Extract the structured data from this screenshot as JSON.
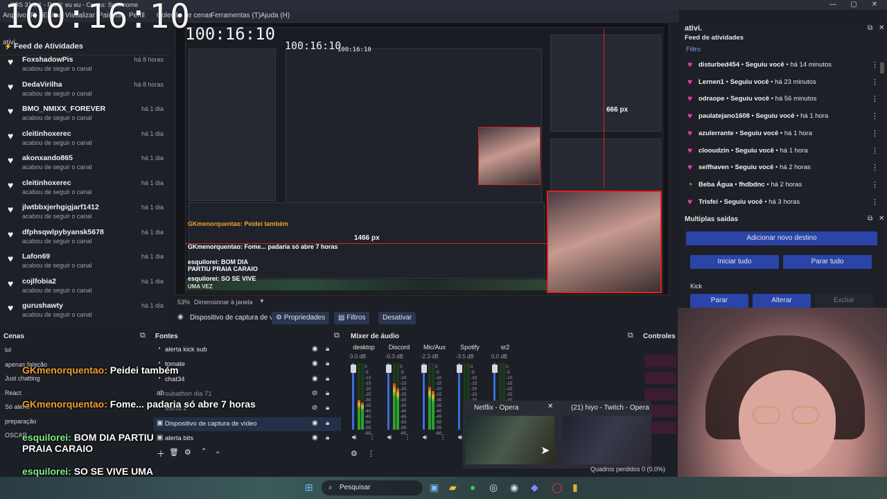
{
  "window": {
    "title": "OBS 31.1.1 - Perfil: eu eu - Cenas: Sem nome",
    "minimize": "—",
    "maximize": "▢",
    "close": "✕"
  },
  "menu": [
    "Arquivo (F)",
    "Editar",
    "Visualizar",
    "Painéis",
    "Perfil",
    "Coleção de cenas",
    "Ferramentas (T)",
    "Ajuda (H)"
  ],
  "clock": "100:16:10",
  "preview_clock_2": "100:16:10",
  "preview_clock_3": "100:16:10",
  "preview_clock_4": "100:16:10",
  "left_feed": {
    "dock_title": "ativi.",
    "title": "Feed de Atividades",
    "items": [
      {
        "name": "FoxshadowPis",
        "sub": "acabou de seguir o canal",
        "time": "há 8 horas"
      },
      {
        "name": "DedaVirilha",
        "sub": "acabou de seguir o canal",
        "time": "há 8 horas"
      },
      {
        "name": "BMO_NMIXX_FOREVER",
        "sub": "acabou de seguir o canal",
        "time": "há 1 dia"
      },
      {
        "name": "cleitinhoxerec",
        "sub": "acabou de seguir o canal",
        "time": "há 1 dia"
      },
      {
        "name": "akonxando865",
        "sub": "acabou de seguir o canal",
        "time": "há 1 dia"
      },
      {
        "name": "cleitinhoxerec",
        "sub": "acabou de seguir o canal",
        "time": "há 1 dia"
      },
      {
        "name": "jlwtbbxjerhgigjarf1412",
        "sub": "acabou de seguir o canal",
        "time": "há 1 dia"
      },
      {
        "name": "dfphsqwlpybyansk5678",
        "sub": "acabou de seguir o canal",
        "time": "há 1 dia"
      },
      {
        "name": "Lafon69",
        "sub": "acabou de seguir o canal",
        "time": "há 1 dia"
      },
      {
        "name": "cojlfobia2",
        "sub": "acabou de seguir o canal",
        "time": "há 1 dia"
      },
      {
        "name": "gurushawty",
        "sub": "acabou de seguir o canal",
        "time": "há 1 dia"
      }
    ]
  },
  "preview": {
    "px_h": "666 px",
    "px_w": "1466 px",
    "chat_inner": [
      "GKmenorquentao: Peidei também",
      "GKmenorquentao: Fome... padaria só abre 7 horas",
      "esquilorei: BOM DIA PARTIU PRAIA CARAIO",
      "esquilorei: SO SE VIVE",
      "UMA VEZ"
    ]
  },
  "zoom": {
    "value": "53%",
    "mode": "Dimensionar à janela"
  },
  "source_bar": {
    "label": "Dispositivo de captura de v",
    "props": "Propriedades",
    "filters": "Filtros",
    "disable": "Desativar"
  },
  "right_feed": {
    "dock_title": "ativi.",
    "title": "Feed de atividades",
    "filter": "Filtro",
    "items": [
      {
        "user": "disturbed454",
        "action": "Seguiu você",
        "time": "há 14 minutos"
      },
      {
        "user": "Lernen1",
        "action": "Seguiu você",
        "time": "há 23 minutos"
      },
      {
        "user": "odraope",
        "action": "Seguiu você",
        "time": "há 56 minutos"
      },
      {
        "user": "paulatejano1608",
        "action": "Seguiu você",
        "time": "há 1 hora"
      },
      {
        "user": "azulerrante",
        "action": "Seguiu você",
        "time": "há 1 hora"
      },
      {
        "user": "clooudzin",
        "action": "Seguiu você",
        "time": "há 1 hora"
      },
      {
        "user": "selfhaven",
        "action": "Seguiu você",
        "time": "há 2 horas"
      },
      {
        "user": "Beba Água",
        "action": "fhdbdnc",
        "time": "há 2 horas"
      },
      {
        "user": "Trisfei",
        "action": "Seguiu você",
        "time": "há 3 horas"
      }
    ]
  },
  "multi": {
    "title": "Multiplas saídas",
    "add": "Adicionar novo destino",
    "start_all": "Iniciar tudo",
    "stop_all": "Parar tudo",
    "dest": "Kick",
    "stop": "Parar",
    "change": "Alterar",
    "delete": "Excluir"
  },
  "scenes": {
    "title": "Cenas",
    "items": [
      "lol",
      "apenas falação",
      "Just chatting",
      "React",
      "Só alerta",
      "preparação",
      "OSCAR"
    ]
  },
  "sources": {
    "title": "Fontes",
    "items": [
      "alerta kick sub",
      "tomate",
      "chat34",
      "subathon dia 71",
      "alerta 2",
      "Dispositivo de captura de vídeo",
      "alerta bits"
    ]
  },
  "mixer": {
    "title": "Mixer de áudio",
    "channels": [
      {
        "name": "desktop",
        "db": "0.0 dB",
        "level": 0.45
      },
      {
        "name": "Discord",
        "db": "-0.3 dB",
        "level": 0.7
      },
      {
        "name": "Mic/Aux",
        "db": "-2.3 dB",
        "level": 0.65
      },
      {
        "name": "Spotify",
        "db": "-3.5 dB",
        "level": 0.3
      },
      {
        "name": "sr2",
        "db": "0.0 dB",
        "level": 0.2
      }
    ],
    "ticks": [
      "0",
      "-5",
      "-10",
      "-15",
      "-20",
      "-25",
      "-30",
      "-35",
      "-40",
      "-45",
      "-50",
      "-55",
      "-60"
    ]
  },
  "controls": {
    "title": "Controles"
  },
  "chat": [
    {
      "user": "GKmenorquentao:",
      "msg": "Peidei também"
    },
    {
      "user": "GKmenorquentao:",
      "msg": "Fome... padaria só abre 7 horas"
    },
    {
      "user": "esquilorei:",
      "msg": "BOM DIA PARTIU PRAIA CARAIO"
    },
    {
      "user": "esquilorei:",
      "msg": "SO SE VIVE UMA VEZ"
    }
  ],
  "thumbs": [
    {
      "title": "Netflix - Opera"
    },
    {
      "title": "(21) hiyo - Twitch - Opera"
    }
  ],
  "frames": "Quadros perdidos 0 (0.0%)",
  "taskbar": {
    "search": "Pesquisar"
  }
}
